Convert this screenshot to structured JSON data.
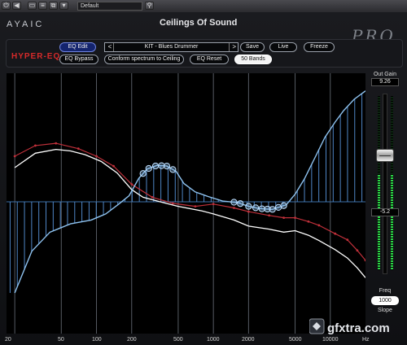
{
  "host": {
    "preset_value": "Default",
    "buttons": [
      "power",
      "bypass",
      "compare",
      "preset-menu",
      "copy",
      "paste",
      "link"
    ]
  },
  "plugin": {
    "brand": "AYAIC",
    "title": "Ceilings Of Sound",
    "edition": "PRO",
    "module": "HYPER-EQ"
  },
  "toolbar": {
    "eq_edit": "EQ Edit",
    "preset_name": "KIT - Blues Drummer",
    "prev_arrow": "<",
    "next_arrow": ">",
    "save": "Save",
    "live": "Live",
    "freeze": "Freeze",
    "eq_bypass": "EQ Bypass",
    "conform": "Conform spectrum to Ceiling",
    "eq_reset": "EQ Reset",
    "bands": "50 Bands"
  },
  "side_panel": {
    "out_gain_label": "Out Gain",
    "out_gain_value": "9.26",
    "meter_value": "-5.2",
    "freq_label": "Freq",
    "freq_value": "1000",
    "slope_label": "Slope"
  },
  "freq_axis": {
    "labels": [
      "20",
      "50",
      "100",
      "200",
      "500",
      "1000",
      "2000",
      "5000",
      "10000",
      "Hz"
    ]
  },
  "colors": {
    "eq_curve": "#8fc3f0",
    "ceiling_curve": "#c0303a",
    "spectrum_curve": "#ffffff",
    "accent_blue": "#14246e",
    "brand_red": "#d52a2a"
  },
  "watermark": {
    "text": "gfxtra.com"
  },
  "chart_data": {
    "type": "line",
    "xscale": "log",
    "xlabel": "Hz",
    "x_ticks": [
      20,
      50,
      100,
      200,
      500,
      1000,
      2000,
      5000,
      10000
    ],
    "series": [
      {
        "key": "eq",
        "points": [
          [
            20,
            -12.0
          ],
          [
            28,
            -6.5
          ],
          [
            40,
            -4.0
          ],
          [
            60,
            -2.9
          ],
          [
            90,
            -2.4
          ],
          [
            120,
            -1.6
          ],
          [
            155,
            -0.3
          ],
          [
            190,
            0.8
          ],
          [
            230,
            3.1
          ],
          [
            270,
            4.3
          ],
          [
            330,
            4.8
          ],
          [
            400,
            4.7
          ],
          [
            480,
            4.0
          ],
          [
            560,
            2.4
          ],
          [
            700,
            1.3
          ],
          [
            900,
            0.7
          ],
          [
            1200,
            0.1
          ],
          [
            1600,
            -0.1
          ],
          [
            2000,
            -0.6
          ],
          [
            2500,
            -0.9
          ],
          [
            3200,
            -1.0
          ],
          [
            4200,
            -0.4
          ],
          [
            5000,
            1.0
          ],
          [
            6000,
            3.0
          ],
          [
            7500,
            6.0
          ],
          [
            9000,
            8.5
          ],
          [
            11000,
            10.5
          ],
          [
            13000,
            12.0
          ],
          [
            16000,
            13.5
          ],
          [
            20000,
            14.6
          ]
        ]
      },
      {
        "key": "ceiling",
        "points": [
          [
            20,
            6.0
          ],
          [
            30,
            7.4
          ],
          [
            45,
            7.7
          ],
          [
            70,
            7.0
          ],
          [
            100,
            6.0
          ],
          [
            140,
            4.7
          ],
          [
            200,
            2.3
          ],
          [
            300,
            0.6
          ],
          [
            450,
            -0.2
          ],
          [
            700,
            -0.6
          ],
          [
            1000,
            -0.3
          ],
          [
            1500,
            -0.8
          ],
          [
            2000,
            -1.3
          ],
          [
            3000,
            -1.8
          ],
          [
            4000,
            -2.1
          ],
          [
            5000,
            -2.1
          ],
          [
            6500,
            -2.6
          ],
          [
            8000,
            -3.1
          ],
          [
            11000,
            -4.2
          ],
          [
            14000,
            -5.0
          ],
          [
            17000,
            -6.4
          ],
          [
            20000,
            -7.7
          ]
        ]
      },
      {
        "key": "spectrum",
        "points": [
          [
            20,
            4.5
          ],
          [
            30,
            6.4
          ],
          [
            45,
            6.9
          ],
          [
            60,
            6.7
          ],
          [
            80,
            6.2
          ],
          [
            110,
            5.3
          ],
          [
            150,
            3.8
          ],
          [
            200,
            1.6
          ],
          [
            250,
            0.6
          ],
          [
            350,
            0.0
          ],
          [
            500,
            -0.6
          ],
          [
            800,
            -1.2
          ],
          [
            1000,
            -1.6
          ],
          [
            1500,
            -2.4
          ],
          [
            2000,
            -3.2
          ],
          [
            3000,
            -3.6
          ],
          [
            4000,
            -4.0
          ],
          [
            5000,
            -3.8
          ],
          [
            6500,
            -4.4
          ],
          [
            8000,
            -5.1
          ],
          [
            11000,
            -6.3
          ],
          [
            14000,
            -7.4
          ],
          [
            17000,
            -8.7
          ],
          [
            20000,
            -10.0
          ]
        ]
      }
    ],
    "selected_band_hz": [
      250,
      280,
      320,
      360,
      400,
      450,
      1500,
      1700,
      2000,
      2300,
      2600,
      2900,
      3200,
      3600,
      4000
    ]
  }
}
